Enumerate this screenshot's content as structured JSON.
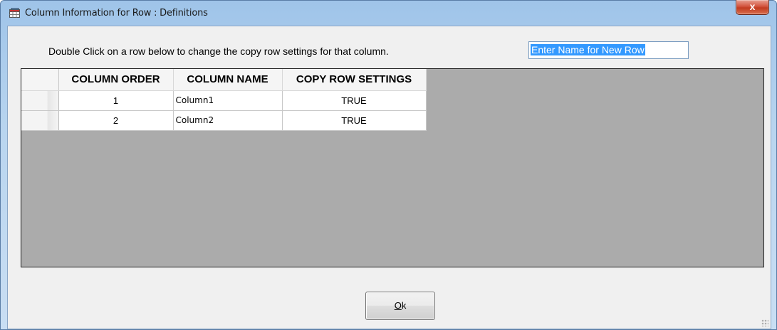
{
  "window": {
    "title": "Column Information for Row : Definitions",
    "close_label": "x"
  },
  "instruction": "Double Click on a row below to change the copy row settings for that column.",
  "new_row_name": {
    "value": "Enter Name for New Row"
  },
  "grid": {
    "columns": [
      "COLUMN ORDER",
      "COLUMN NAME",
      "COPY ROW SETTINGS"
    ],
    "rows": [
      {
        "order": "1",
        "name": "Column1",
        "copy": "TRUE"
      },
      {
        "order": "2",
        "name": "Column2",
        "copy": "TRUE"
      }
    ]
  },
  "ok_button": {
    "mnemonic": "O",
    "rest": "k"
  },
  "icons": {
    "title_icon": "table-window-icon",
    "close_icon": "close-icon",
    "resize_grip": "resize-grip-icon"
  },
  "colors": {
    "grid_background": "#ababab",
    "selection": "#3399ff",
    "close_button": "#c23b20"
  }
}
